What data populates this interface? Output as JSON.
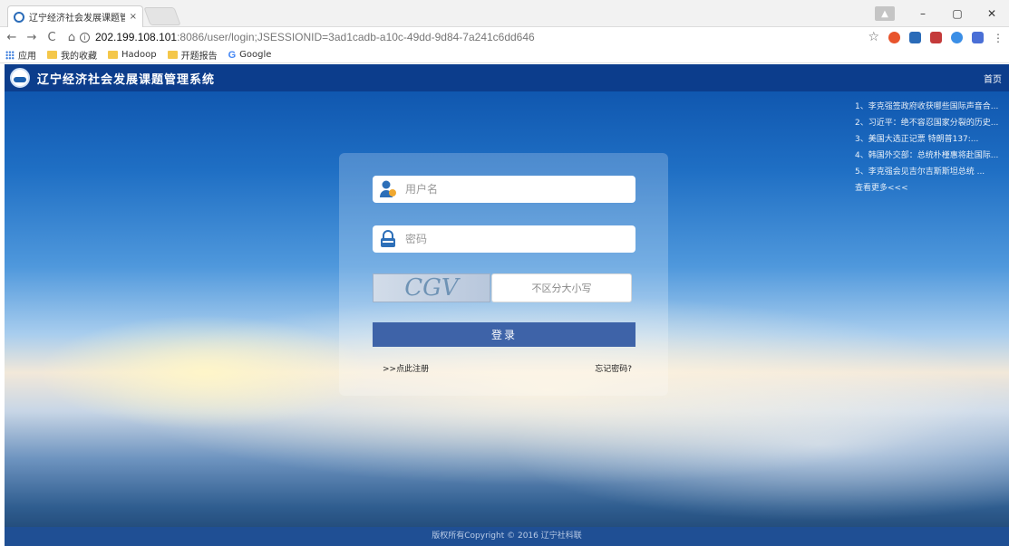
{
  "browser": {
    "tab_title": "辽宁经济社会发展课题管",
    "tab_close": "×",
    "window_buttons": {
      "minimize": "–",
      "maximize": "▢",
      "close": "✕"
    },
    "nav": {
      "back": "←",
      "forward": "→",
      "reload": "C",
      "home": "⌂"
    },
    "url_host": "202.199.108.101",
    "url_rest": ":8086/user/login;JSESSIONID=3ad1cadb-a10c-49dd-9d84-7a241c6dd646",
    "star": "☆",
    "menu": "⋮",
    "bookmarks": [
      {
        "label": "应用",
        "icon": "apps-grid-icon"
      },
      {
        "label": "我的收藏",
        "icon": "folder-icon"
      },
      {
        "label": "Hadoop",
        "icon": "folder-icon"
      },
      {
        "label": "开题报告",
        "icon": "folder-icon"
      },
      {
        "label": "Google",
        "icon": "google-icon"
      }
    ],
    "google_letter": "G",
    "extension_colors": [
      "#e8542c",
      "#2a6bb8",
      "#c43a3a",
      "#3a8ee6",
      "#4a6fd6"
    ]
  },
  "site": {
    "title": "辽宁经济社会发展课题管理系统",
    "home_link": "首页"
  },
  "news": [
    "1、李克强签政府收获哪些国际声音合...",
    "2、习近平：绝不容忍国家分裂的历史...",
    "3、美国大选正记票 特朗普137:...",
    "4、韩国外交部：总统朴槿惠将赴国际...",
    "5、李克强会见吉尔吉斯斯坦总统 ..."
  ],
  "news_more": "查看更多<<<",
  "login": {
    "username_placeholder": "用户名",
    "password_placeholder": "密码",
    "captcha_text": "CGV",
    "captcha_placeholder": "不区分大小写",
    "login_button": "登录",
    "register_link": ">>点此注册",
    "forgot_link": "忘记密码?"
  },
  "footer": "版权所有Copyright © 2016 辽宁社科联"
}
